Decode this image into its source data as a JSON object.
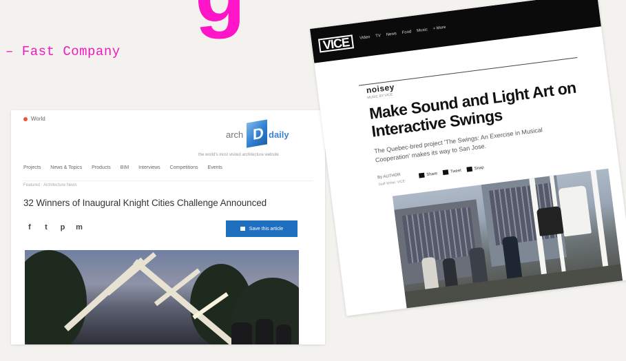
{
  "heading_glyph": "g",
  "quote_source": "– Fast Company",
  "archdaily": {
    "topbar": "World",
    "logo_arch": "arch",
    "logo_cube": "D",
    "logo_daily": "daily",
    "tagline": "the world's most visited architecture website",
    "nav": [
      "Projects",
      "News & Topics",
      "Products",
      "BIM",
      "Interviews",
      "Competitions",
      "Events"
    ],
    "breadcrumb": "Featured  ·  Architecture News",
    "title": "32 Winners of Inaugural Knight Cities Challenge Announced",
    "share_icons": [
      "f",
      "t",
      "p",
      "m"
    ],
    "save_label": "Save this article"
  },
  "vice": {
    "logo": "VICE",
    "nav": [
      "Video",
      "TV",
      "News",
      "Food",
      "Music",
      "+ More"
    ],
    "section": "noisey",
    "section_sub": "MUSIC BY VICE",
    "headline": "Make Sound and Light Art on Interactive Swings",
    "dek": "The Quebec-bred project 'The Swings: An Exercise in Musical Cooperation' makes its way to San Jose.",
    "byline": "By AUTHOR",
    "byline_sub": "Staff Writer, VICE",
    "share": [
      "Share",
      "Tweet",
      "Snap"
    ]
  }
}
